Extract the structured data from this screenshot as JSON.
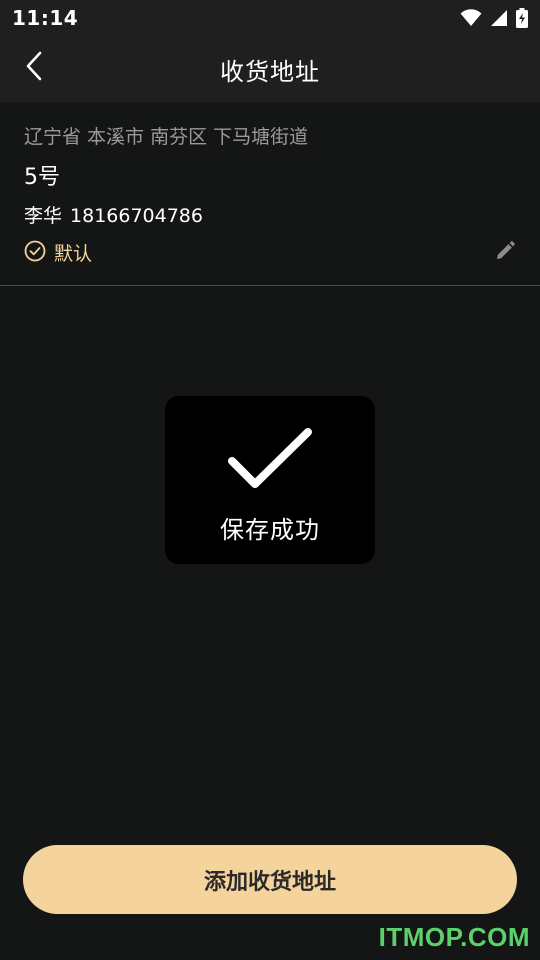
{
  "status_bar": {
    "time": "11:14",
    "icons": [
      "wifi-icon",
      "signal-icon",
      "battery-charging-icon"
    ]
  },
  "app_bar": {
    "title": "收货地址",
    "back_icon": "chevron-left-icon"
  },
  "address": {
    "region": "辽宁省 本溪市 南芬区 下马塘街道",
    "detail": "5号",
    "name": "李华",
    "phone": "18166704786",
    "default_label": "默认",
    "default_icon": "check-circle-icon",
    "edit_icon": "pencil-icon"
  },
  "toast": {
    "icon": "checkmark-icon",
    "message": "保存成功"
  },
  "footer": {
    "add_button_label": "添加收货地址"
  },
  "watermark": {
    "text": "ITMOP.COM"
  },
  "colors": {
    "background": "#141515",
    "bar": "#1f1f1f",
    "accent": "#f4d39c",
    "secondary_text": "#9a9a9a",
    "watermark": "#5cd06b"
  }
}
